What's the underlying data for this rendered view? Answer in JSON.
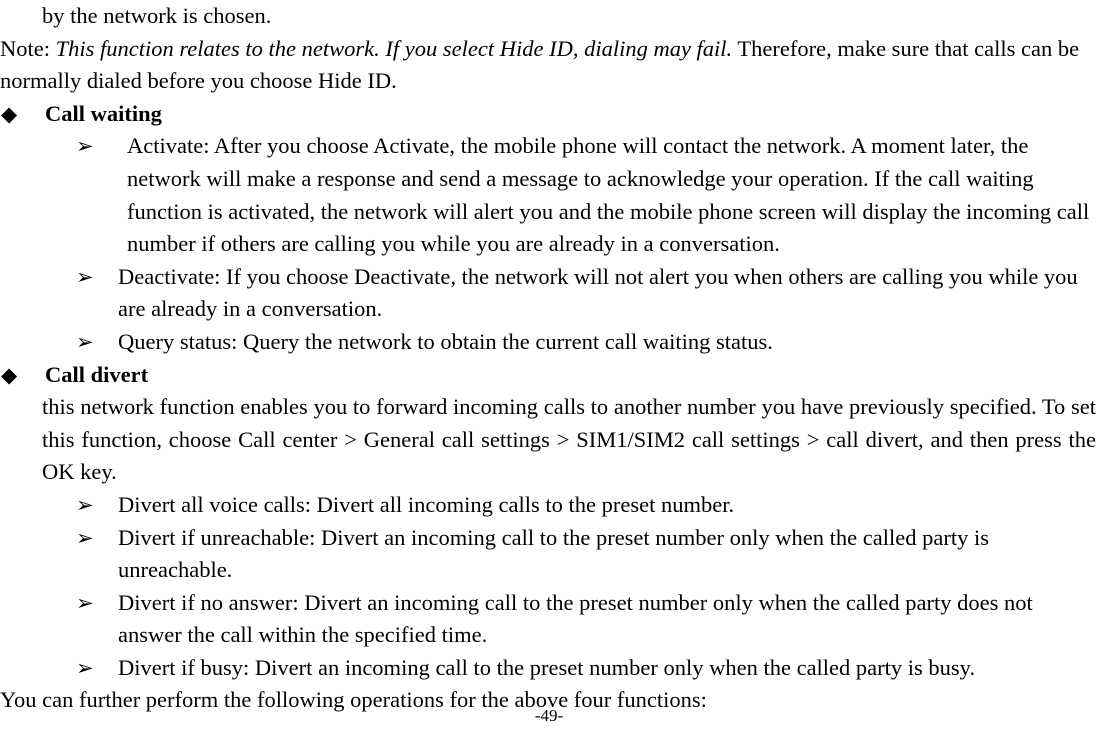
{
  "document": {
    "page_number_label": "-49-",
    "bullets": {
      "level1_marker": "◆",
      "level2_marker": "➢"
    },
    "blocks": [
      {
        "id": "continued-line",
        "type": "continuation",
        "text": "by the network is chosen."
      },
      {
        "id": "note-paragraph",
        "type": "paragraph",
        "lead": "Note: ",
        "italic": "This function relates to the network. If you select Hide ID, dialing may fail.",
        "tail": " Therefore, make sure that calls can be normally dialed before you choose Hide ID."
      },
      {
        "id": "heading-call-waiting",
        "type": "heading",
        "text": "Call waiting"
      },
      {
        "id": "item-activate",
        "type": "list-item",
        "text": "Activate: After you choose Activate, the mobile phone will contact the network. A moment later, the network will make a response and send a message to acknowledge your operation. If the call waiting function is activated, the network will alert you and the mobile phone screen will display the incoming call number if others are calling you while you are already in a conversation."
      },
      {
        "id": "item-deactivate",
        "type": "list-item",
        "text": "Deactivate: If you choose Deactivate, the network will not alert you when others are calling you while you are already in a conversation."
      },
      {
        "id": "item-query-status",
        "type": "list-item",
        "text": "Query status: Query the network to obtain the current call waiting status."
      },
      {
        "id": "heading-call-divert",
        "type": "heading",
        "text": "Call divert"
      },
      {
        "id": "paragraph-call-divert",
        "type": "paragraph-justified",
        "text": "this network function enables you to forward incoming calls to another number you have previously specified. To set this function, choose Call center > General call settings > SIM1/SIM2 call settings > call divert, and then press the OK key."
      },
      {
        "id": "item-divert-all-voice-calls",
        "type": "list-item",
        "text": "Divert all voice calls: Divert all incoming calls to the preset number."
      },
      {
        "id": "item-divert-if-unreachable",
        "type": "list-item",
        "text": "Divert if unreachable: Divert an incoming call to the preset number only when the called party is unreachable."
      },
      {
        "id": "item-divert-if-no-answer",
        "type": "list-item",
        "text": "Divert if no answer: Divert an incoming call to the preset number only when the called party does not answer the call within the specified time."
      },
      {
        "id": "item-divert-if-busy",
        "type": "list-item",
        "text": "Divert if busy: Divert an incoming call to the preset number only when the called party is busy."
      },
      {
        "id": "closing-line",
        "type": "paragraph",
        "text": "You can further perform the following operations for the above four functions:"
      }
    ]
  }
}
